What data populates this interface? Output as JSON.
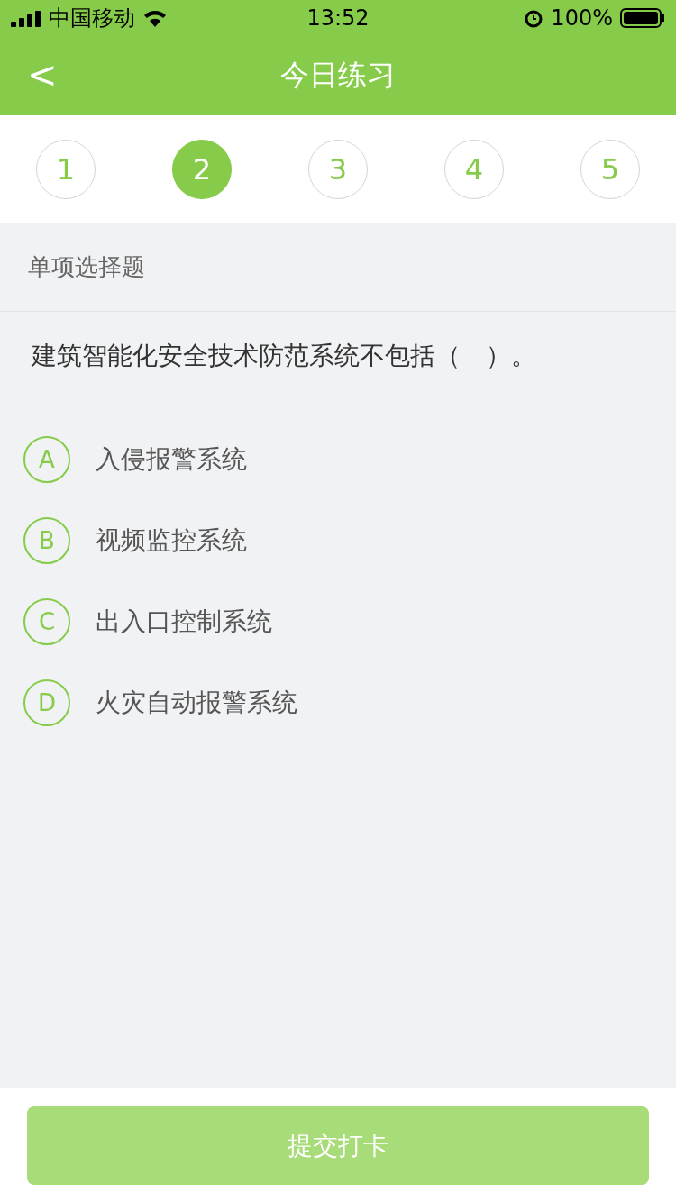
{
  "status_bar": {
    "carrier": "中国移动",
    "time": "13:52",
    "battery": "100%"
  },
  "nav": {
    "back": "<",
    "title": "今日练习"
  },
  "steps": [
    {
      "label": "1",
      "selected": false
    },
    {
      "label": "2",
      "selected": true
    },
    {
      "label": "3",
      "selected": false
    },
    {
      "label": "4",
      "selected": false
    },
    {
      "label": "5",
      "selected": false
    }
  ],
  "question": {
    "type": "单项选择题",
    "text": "建筑智能化安全技术防范系统不包括（　）。"
  },
  "options": [
    {
      "letter": "A",
      "text": "入侵报警系统",
      "selected": false
    },
    {
      "letter": "B",
      "text": "视频监控系统",
      "selected": false
    },
    {
      "letter": "C",
      "text": "出入口控制系统",
      "selected": false
    },
    {
      "letter": "D",
      "text": "火灾自动报警系统",
      "selected": false
    }
  ],
  "submit": {
    "label": "提交打卡",
    "disabled": true
  }
}
